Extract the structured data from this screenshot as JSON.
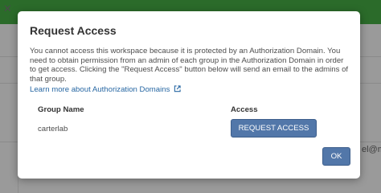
{
  "background": {
    "partial_text": "el@m"
  },
  "dialog": {
    "title": "Request Access",
    "body": "You cannot access this workspace because it is protected by an Authorization Domain. You need to obtain permission from an admin of each group in the Authorization Domain in order to get access. Clicking the \"Request Access\" button below will send an email to the admins of that group.",
    "learn_more_link": "Learn more about Authorization Domains",
    "external_link_icon": "external-link-icon",
    "table": {
      "headers": [
        "Group Name",
        "Access"
      ],
      "rows": [
        {
          "group": "carterlab",
          "action_label": "REQUEST ACCESS"
        }
      ]
    },
    "ok_label": "OK"
  },
  "colors": {
    "header_green": "#2b6b2a",
    "primary_button": "#5277a9",
    "link": "#2767a3"
  }
}
